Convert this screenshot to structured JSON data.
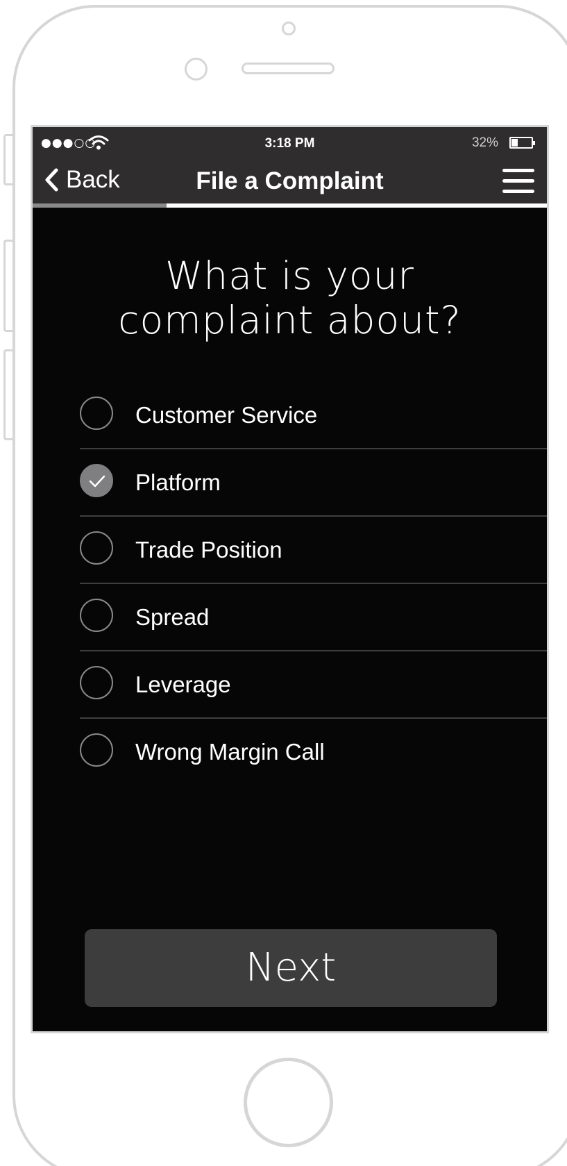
{
  "status_bar": {
    "signal": "●●●○○",
    "time": "3:18 PM",
    "battery_percent": "32%",
    "battery_level": 0.32
  },
  "nav": {
    "back_label": "Back",
    "title": "File a Complaint",
    "progress": 0.26
  },
  "question": {
    "line1": "What is your",
    "line2": "complaint about?"
  },
  "options": [
    {
      "label": "Customer Service",
      "checked": false
    },
    {
      "label": "Platform",
      "checked": true
    },
    {
      "label": "Trade Position",
      "checked": false
    },
    {
      "label": "Spread",
      "checked": false
    },
    {
      "label": "Leverage",
      "checked": false
    },
    {
      "label": "Wrong Margin Call",
      "checked": false
    }
  ],
  "actions": {
    "next_label": "Next"
  },
  "colors": {
    "screen_bg": "#060606",
    "bar_bg": "#2f2d2e",
    "button_bg": "#3d3d3d",
    "checked_fill": "#7f7f82",
    "frame": "#d6d6d6"
  }
}
